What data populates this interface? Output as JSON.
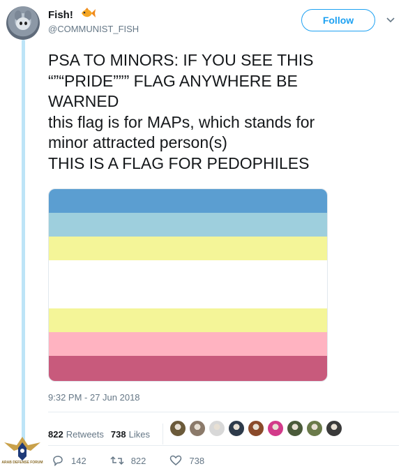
{
  "user": {
    "display_name": "Fish!",
    "handle": "@COMMUNIST_FISH"
  },
  "header": {
    "follow_label": "Follow"
  },
  "tweet": {
    "lines": [
      "PSA TO MINORS: IF YOU SEE THIS",
      "“”“PRIDE””” FLAG ANYWHERE BE",
      "WARNED",
      "this flag is for MAPs, which stands for",
      "minor attracted person(s)",
      "THIS IS A FLAG FOR PEDOPHILES"
    ],
    "timestamp": "9:32 PM - 27 Jun 2018"
  },
  "flag": {
    "stripes": [
      "#5b9ed1",
      "#9ecfdd",
      "#f4f598",
      "#ffffff",
      "#f4f598",
      "#ffb3c1",
      "#c85a7c"
    ]
  },
  "stats": {
    "retweets_count": "822",
    "retweets_label": "Retweets",
    "likes_count": "738",
    "likes_label": "Likes",
    "liker_colors": [
      "#6b5a3a",
      "#8b7a6a",
      "#d8d8d8",
      "#2d3a4a",
      "#8a4a2a",
      "#d23a8a",
      "#4a5a3a",
      "#6a7a4a",
      "#3a3a3a"
    ]
  },
  "actions": {
    "replies": "142",
    "retweets": "822",
    "likes": "738"
  },
  "watermark": {
    "text": "ARAB DEFENSE FORUM"
  },
  "colors": {
    "accent": "#1da1f2",
    "thread_line": "#bde4f7",
    "muted": "#657786"
  }
}
